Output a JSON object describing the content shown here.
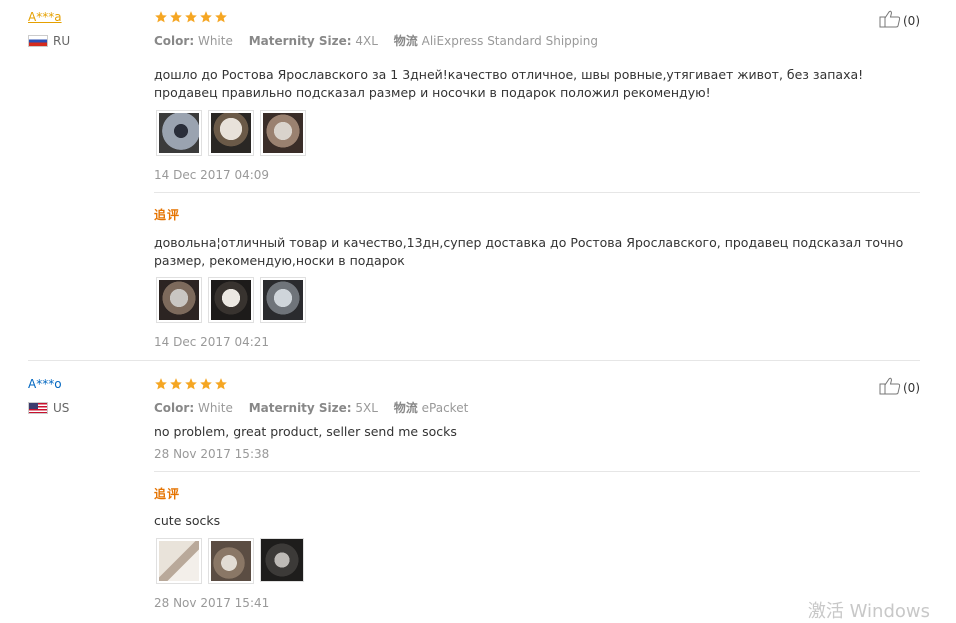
{
  "reviews": [
    {
      "user": "A***a",
      "country": "RU",
      "meta": {
        "color_label": "Color:",
        "color_value": "White",
        "size_label": "Maternity Size:",
        "size_value": "4XL",
        "ship_label": "物流",
        "ship_value": "AliExpress Standard Shipping"
      },
      "likes": "(0)",
      "text": "дошло до Ростова Ярославского за 1 3дней!качество отличное, швы ровные,утягивает живот, без запаха! продавец правильно подсказал размер и носочки в подарок положил рекомендую!",
      "date": "14 Dec 2017 04:09",
      "followup_label": "追评",
      "followup_text": "довольна¦отличный товар и качество,13дн,супер доставка до Ростова Ярославского, продавец подсказал точно размер, рекомендую,носки в подарок",
      "followup_date": "14 Dec 2017 04:21"
    },
    {
      "user": "A***o",
      "country": "US",
      "meta": {
        "color_label": "Color:",
        "color_value": "White",
        "size_label": "Maternity Size:",
        "size_value": "5XL",
        "ship_label": "物流",
        "ship_value": "ePacket"
      },
      "likes": "(0)",
      "text": "no problem, great product, seller send me socks",
      "date": "28 Nov 2017 15:38",
      "followup_label": "追评",
      "followup_text": "cute socks",
      "followup_date": "28 Nov 2017 15:41"
    }
  ],
  "watermark": "激活 Windows",
  "colors": {
    "star": "#f5a623",
    "followup": "#e57300",
    "username_orange": "#e5a000",
    "username_blue": "#0066c0"
  }
}
